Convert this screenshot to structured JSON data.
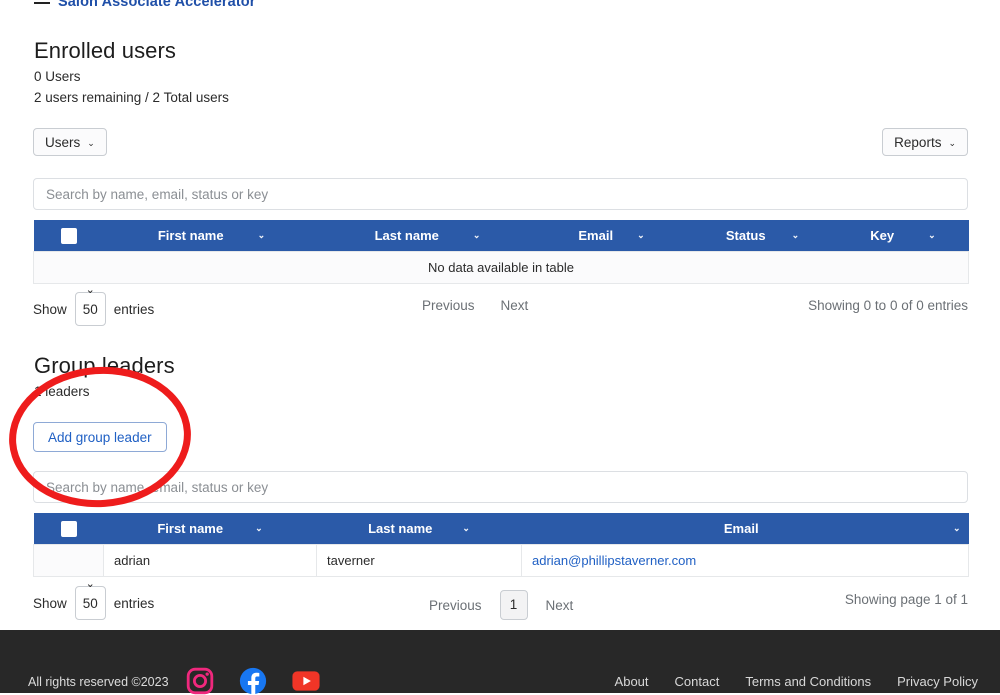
{
  "breadcrumb": {
    "label": "Salon Associate Accelerator"
  },
  "enrolled": {
    "title": "Enrolled users",
    "count_line": "0 Users",
    "remaining_line": "2 users remaining / 2 Total users",
    "users_button": "Users",
    "reports_button": "Reports",
    "caret": "⌄",
    "search_placeholder": "Search by name, email, status or key",
    "search_value": "",
    "columns": [
      "First name",
      "Last name",
      "Email",
      "Status",
      "Key"
    ],
    "empty_message": "No data available in table",
    "footer": {
      "show_label": "Show",
      "entries_label": "entries",
      "page_length": "50",
      "previous": "Previous",
      "next": "Next",
      "info": "Showing 0 to 0 of 0 entries"
    }
  },
  "group_leaders": {
    "title": "Group leaders",
    "count_line": "1 leaders",
    "add_button": "Add group leader",
    "search_placeholder": "Search by name, email, status or key",
    "search_value": "",
    "columns": [
      "First name",
      "Last name",
      "Email"
    ],
    "rows": [
      {
        "first_name": "adrian",
        "last_name": "taverner",
        "email": "adrian@phillipstaverner.com"
      }
    ],
    "footer": {
      "show_label": "Show",
      "entries_label": "entries",
      "page_length": "50",
      "previous": "Previous",
      "page_number": "1",
      "next": "Next",
      "info": "Showing page 1 of 1"
    }
  },
  "annotation": {
    "shape": "red-ellipse-highlight",
    "color": "#ee1c1c",
    "target": "Add group leader"
  },
  "site_footer": {
    "copyright": "All rights reserved ©2023",
    "social": [
      "instagram-icon",
      "facebook-icon",
      "youtube-icon"
    ],
    "links": [
      "About",
      "Contact",
      "Terms and Conditions",
      "Privacy Policy"
    ]
  },
  "colors": {
    "table_header_blue": "#2b5aa8",
    "link_blue": "#2060c4",
    "brand_blue": "#1f4fa8",
    "annotation_red": "#ee1c1c",
    "footer_dark": "#282828",
    "instagram_pink": "#f0287d",
    "facebook_blue": "#1877f2",
    "youtube_red": "#f03527"
  }
}
